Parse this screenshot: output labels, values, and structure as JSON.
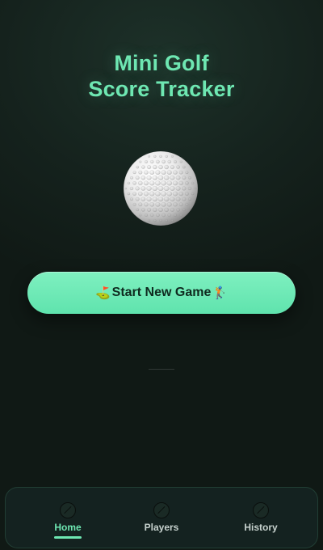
{
  "header": {
    "title_line1": "Mini Golf",
    "title_line2": "Score Tracker"
  },
  "hero": {
    "icon": "golf-ball-icon"
  },
  "main": {
    "start_button": {
      "prefix_emoji": "⛳",
      "label": "Start New Game",
      "suffix_emoji": "🏌️"
    }
  },
  "tabbar": {
    "active": "Home",
    "tabs": [
      {
        "label": "Home",
        "icon": "home-icon"
      },
      {
        "label": "Players",
        "icon": "players-icon"
      },
      {
        "label": "History",
        "icon": "history-icon"
      }
    ]
  },
  "colors": {
    "accent": "#6ee7b2",
    "background": "#15221d",
    "button_text": "#0f2a1f"
  }
}
